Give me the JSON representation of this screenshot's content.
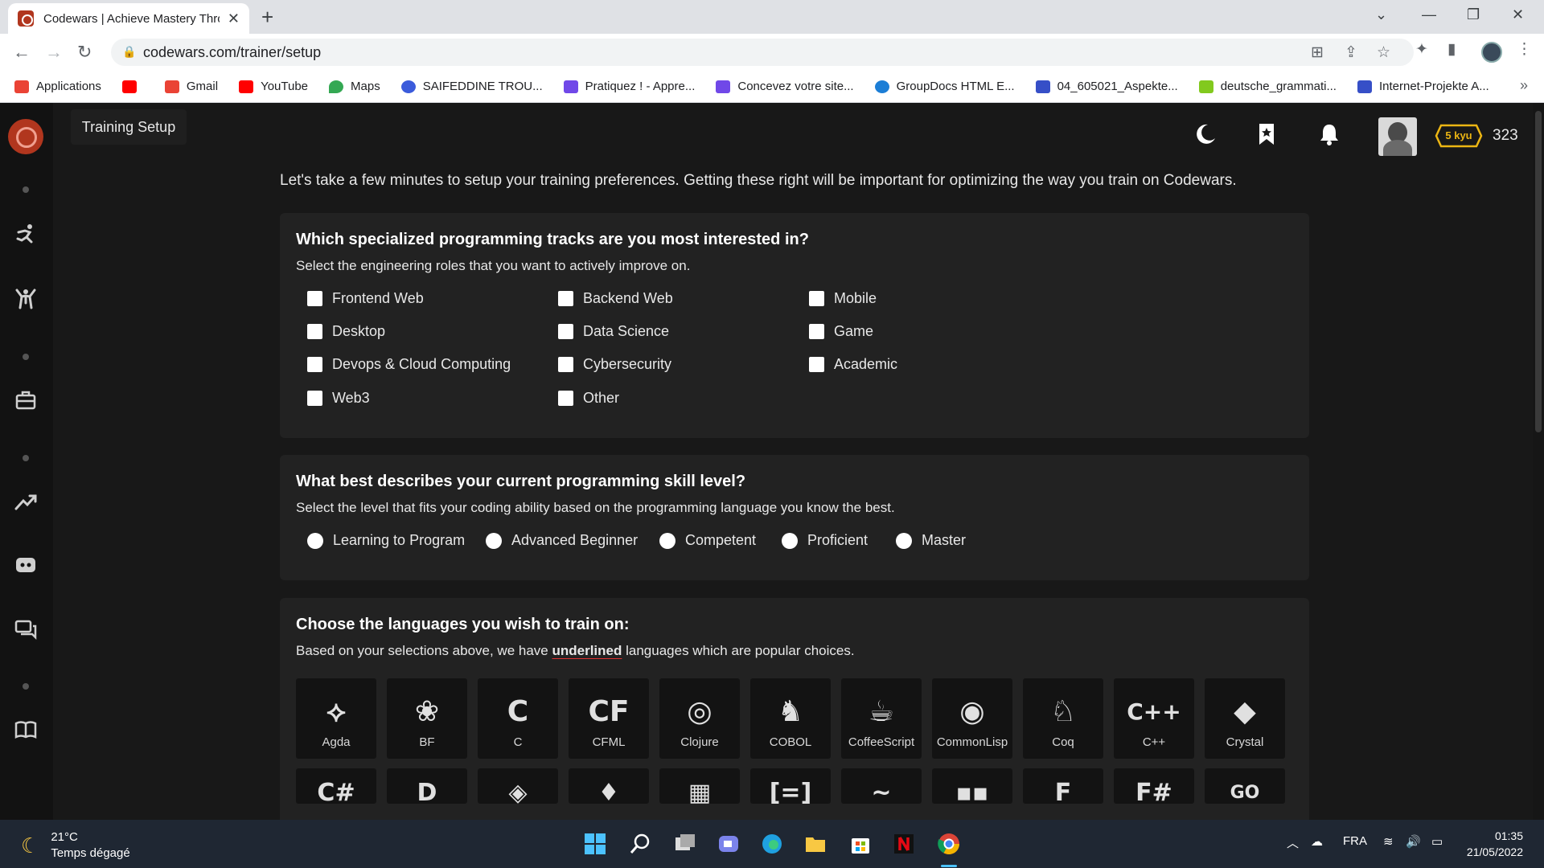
{
  "browser": {
    "tab_title": "Codewars | Achieve Mastery Thro",
    "url": "codewars.com/trainer/setup",
    "bookmarks": [
      {
        "label": "Applications",
        "color": "#ea4335"
      },
      {
        "label": "",
        "color": "#ff0000"
      },
      {
        "label": "Gmail",
        "color": "#ea4335"
      },
      {
        "label": "YouTube",
        "color": "#ff0000"
      },
      {
        "label": "Maps",
        "color": "#34a853"
      },
      {
        "label": "SAIFEDDINE TROU...",
        "color": "#3b5bdb"
      },
      {
        "label": "Pratiquez ! - Appre...",
        "color": "#7048e8"
      },
      {
        "label": "Concevez votre site...",
        "color": "#7048e8"
      },
      {
        "label": "GroupDocs HTML E...",
        "color": "#1c7ed6"
      },
      {
        "label": "04_605021_Aspekte...",
        "color": "#364fc7"
      },
      {
        "label": "deutsche_grammati...",
        "color": "#82c91e"
      },
      {
        "label": "Internet-Projekte A...",
        "color": "#364fc7"
      }
    ]
  },
  "header": {
    "page_title": "Training Setup",
    "rank": "5 kyu",
    "honor": "323",
    "accent": "#ecb613"
  },
  "intro": "Let's take a few minutes to setup your training preferences. Getting these right will be important for optimizing the way you train on Codewars.",
  "tracks": {
    "title": "Which specialized programming tracks are you most interested in?",
    "subtitle": "Select the engineering roles that you want to actively improve on.",
    "options": [
      "Frontend Web",
      "Backend Web",
      "Mobile",
      "Desktop",
      "Data Science",
      "Game",
      "Devops & Cloud Computing",
      "Cybersecurity",
      "Academic",
      "Web3",
      "Other"
    ]
  },
  "skill": {
    "title": "What best describes your current programming skill level?",
    "subtitle": "Select the level that fits your coding ability based on the programming language you know the best.",
    "options": [
      "Learning to Program",
      "Advanced Beginner",
      "Competent",
      "Proficient",
      "Master"
    ]
  },
  "languages": {
    "title": "Choose the languages you wish to train on:",
    "subtitle_pre": "Based on your selections above, we have ",
    "subtitle_em": "underlined",
    "subtitle_post": " languages which are popular choices.",
    "row1": [
      {
        "name": "Agda",
        "glyph": "⟡"
      },
      {
        "name": "BF",
        "glyph": "❀"
      },
      {
        "name": "C",
        "glyph": "C"
      },
      {
        "name": "CFML",
        "glyph": "CF"
      },
      {
        "name": "Clojure",
        "glyph": "◎"
      },
      {
        "name": "COBOL",
        "glyph": "♞"
      },
      {
        "name": "CoffeeScript",
        "glyph": "☕"
      },
      {
        "name": "CommonLisp",
        "glyph": "◉"
      },
      {
        "name": "Coq",
        "glyph": "♘"
      },
      {
        "name": "C++",
        "glyph": "C++"
      },
      {
        "name": "Crystal",
        "glyph": "◆"
      }
    ],
    "row2": [
      {
        "glyph": "C#"
      },
      {
        "glyph": "D"
      },
      {
        "glyph": "◈"
      },
      {
        "glyph": "♦"
      },
      {
        "glyph": "▦"
      },
      {
        "glyph": "[=]"
      },
      {
        "glyph": "~"
      },
      {
        "glyph": "▪▪"
      },
      {
        "glyph": "F"
      },
      {
        "glyph": "F#"
      },
      {
        "glyph": "GO"
      }
    ]
  },
  "taskbar": {
    "temperature": "21°C",
    "weather": "Temps dégagé",
    "language": "FRA",
    "time": "01:35",
    "date": "21/05/2022"
  }
}
